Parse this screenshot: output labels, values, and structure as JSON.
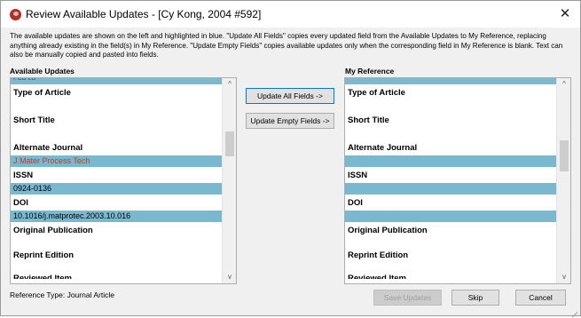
{
  "window": {
    "title": "Review Available Updates - [Cy Kong, 2004 #592]",
    "close_glyph": "✕"
  },
  "intro": "The available updates are shown on the left and highlighted in blue. \"Update All Fields\" copies every updated field from the Available Updates to My Reference, replacing anything already existing in the field(s) in My Reference. \"Update Empty Fields\" copies available updates only when the corresponding field in My Reference is blank. Text can also be manually copied and pasted into fields.",
  "left_panel": {
    "label": "Available Updates",
    "top_clip": "PCD LB",
    "fields": {
      "type_of_article": "Type of Article",
      "short_title": "Short Title",
      "alternate_journal": "Alternate Journal",
      "alternate_journal_value": "J Mater Process Tech",
      "issn": "ISSN",
      "issn_value": "0924-0136",
      "doi": "DOI",
      "doi_value": "10.1016/j.matprotec.2003.10.016",
      "original_publication": "Original Publication",
      "reprint_edition": "Reprint Edition",
      "bottom_clip": "Reviewed Item"
    }
  },
  "right_panel": {
    "label": "My Reference",
    "fields": {
      "type_of_article": "Type of Article",
      "short_title": "Short Title",
      "alternate_journal": "Alternate Journal",
      "issn": "ISSN",
      "doi": "DOI",
      "original_publication": "Original Publication",
      "reprint_edition": "Reprint Edition",
      "bottom_clip": "Reviewed Item"
    }
  },
  "buttons": {
    "update_all": "Update All Fields ->",
    "update_empty": "Update Empty Fields ->",
    "save": "Save Updates",
    "skip": "Skip",
    "cancel": "Cancel"
  },
  "scroll_up_glyph": "^",
  "scroll_down_glyph": "v",
  "footer": {
    "reference_type": "Reference Type: Journal Article"
  },
  "icons": {
    "app": "endnote-app-icon",
    "close": "close-icon",
    "resize": "resize-grip-icon"
  }
}
